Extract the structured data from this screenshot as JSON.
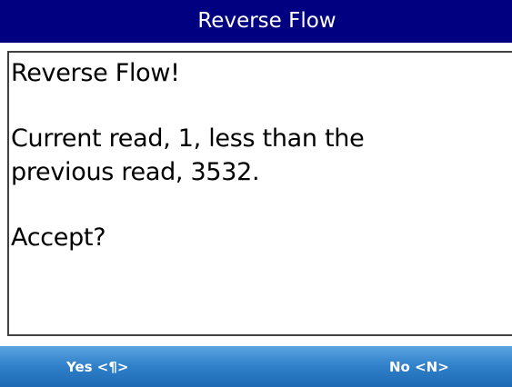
{
  "window": {
    "title": "Reverse Flow"
  },
  "message": {
    "line_heading": "Reverse Flow!",
    "line_body_1": "Current read, 1, less than the",
    "line_body_2": "previous read, 3532.",
    "line_prompt": "Accept?"
  },
  "softkeys": {
    "left_label": "Yes <¶>",
    "right_label": "No <N>"
  },
  "colors": {
    "titlebar": "#000080",
    "softkey_bar": "#2f7fc9",
    "text": "#000000"
  }
}
